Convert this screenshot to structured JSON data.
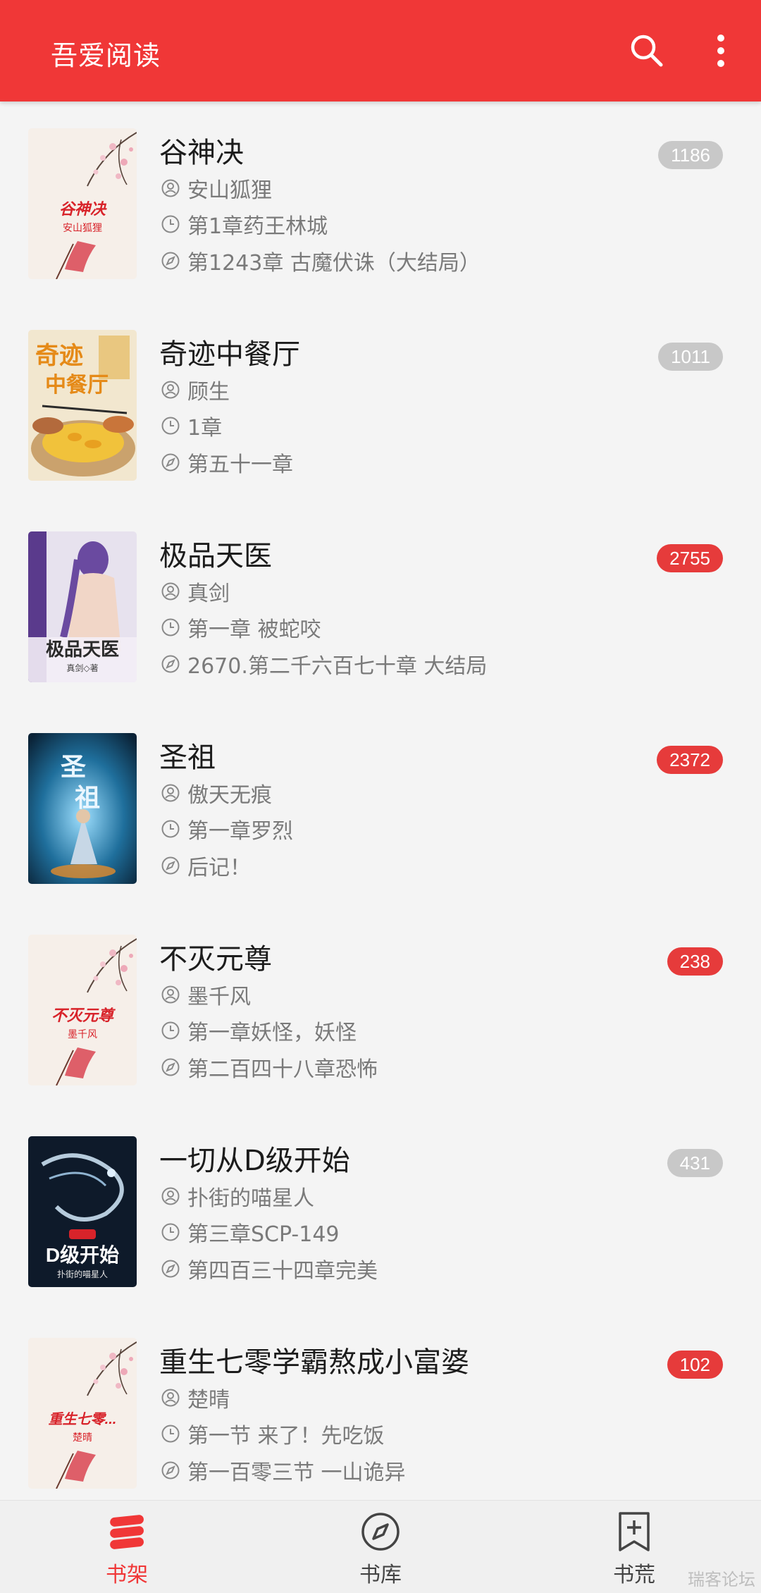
{
  "app": {
    "title": "吾爱阅读",
    "accent": "#f03737"
  },
  "icons": {
    "search": "search-icon",
    "more": "more-vertical-icon",
    "author": "user-circle-icon",
    "durrent_chapter": "clock-icon",
    "latest_chapter": "compass-icon"
  },
  "books": [
    {
      "title": "谷神决",
      "author": "安山狐狸",
      "current": "第1章药王林城",
      "latest": "第1243章 古魔伏诛（大结局）",
      "unread": "1186",
      "badge_color": "grey",
      "cover_title": "谷神决",
      "cover_author": "安山狐狸"
    },
    {
      "title": "奇迹中餐厅",
      "author": "顾生",
      "current": "1章",
      "latest": "第五十一章",
      "unread": "1011",
      "badge_color": "grey",
      "cover_title": "奇迹中餐厅",
      "cover_author": ""
    },
    {
      "title": "极品天医",
      "author": "真剑",
      "current": "第一章 被蛇咬",
      "latest": "2670.第二千六百七十章 大结局",
      "unread": "2755",
      "badge_color": "red",
      "cover_title": "极品天医",
      "cover_author": "真剑◇著"
    },
    {
      "title": "圣祖",
      "author": "傲天无痕",
      "current": "第一章罗烈",
      "latest": "后记！",
      "unread": "2372",
      "badge_color": "red",
      "cover_title": "圣祖",
      "cover_author": ""
    },
    {
      "title": "不灭元尊",
      "author": "墨千风",
      "current": "第一章妖怪，妖怪",
      "latest": "第二百四十八章恐怖",
      "unread": "238",
      "badge_color": "red",
      "cover_title": "不灭元尊",
      "cover_author": "墨千风"
    },
    {
      "title": "一切从D级开始",
      "author": "扑街的喵星人",
      "current": "第三章SCP-149",
      "latest": "第四百三十四章完美",
      "unread": "431",
      "badge_color": "grey",
      "cover_title": "D级开始",
      "cover_author": "扑街的喵星人"
    },
    {
      "title": "重生七零学霸熬成小富婆",
      "author": "楚晴",
      "current": "第一节 来了！先吃饭",
      "latest": "第一百零三节 一山诡异",
      "unread": "102",
      "badge_color": "red",
      "cover_title": "重生七零...",
      "cover_author": "楚晴"
    }
  ],
  "bottom_nav": {
    "shelf": {
      "label": "书架",
      "icon": "bookshelf-s-icon",
      "active": true
    },
    "store": {
      "label": "书库",
      "icon": "compass-icon"
    },
    "discover": {
      "label": "书荒",
      "icon": "bookmark-plus-icon"
    }
  },
  "watermark": "瑞客论坛"
}
